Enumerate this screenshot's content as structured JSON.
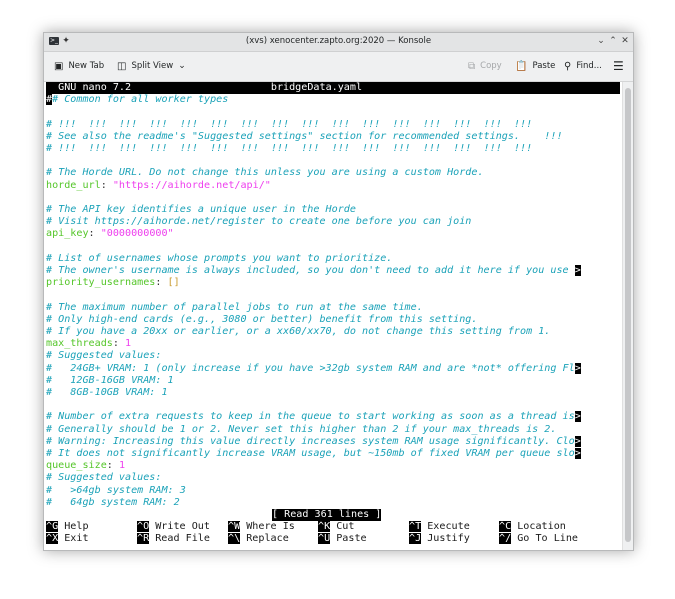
{
  "window": {
    "title": "(xvs) xenocenter.zapto.org:2020 — Konsole"
  },
  "toolbar": {
    "new_tab": "New Tab",
    "split_view": "Split View",
    "copy": "Copy",
    "paste": "Paste",
    "find": "Find..."
  },
  "nano": {
    "version": "GNU nano 7.2",
    "filename": "bridgeData.yaml",
    "status": "[ Read 361 lines ]"
  },
  "lines": {
    "l0": "# Common for all worker types",
    "l2": "# !!!  !!!  !!!  !!!  !!!  !!!  !!!  !!!  !!!  !!!  !!!  !!!  !!!  !!!  !!!  !!!",
    "l3": "# See also the readme's \"Suggested settings\" section for recommended settings.    !!!",
    "l4": "# !!!  !!!  !!!  !!!  !!!  !!!  !!!  !!!  !!!  !!!  !!!  !!!  !!!  !!!  !!!  !!!",
    "l6": "# The Horde URL. Do not change this unless you are using a custom Horde.",
    "l7k": "horde_url",
    "l7v": "\"https://aihorde.net/api/\"",
    "l9": "# The API key identifies a unique user in the Horde",
    "l10": "# Visit https://aihorde.net/register to create one before you can join",
    "l11k": "api_key",
    "l11v": "\"0000000000\"",
    "l13": "# List of usernames whose prompts you want to prioritize.",
    "l14": "# The owner's username is always included, so you don't need to add it here if you use ",
    "l15k": "priority_usernames",
    "l15v": "[]",
    "l17": "# The maximum number of parallel jobs to run at the same time.",
    "l18": "# Only high-end cards (e.g., 3080 or better) benefit from this setting.",
    "l19": "# If you have a 20xx or earlier, or a xx60/xx70, do not change this setting from 1.",
    "l20k": "max_threads",
    "l20v": "1",
    "l21": "# Suggested values:",
    "l22": "#   24GB+ VRAM: 1 (only increase if you have >32gb system RAM and are *not* offering Fl",
    "l23": "#   12GB-16GB VRAM: 1",
    "l24": "#   8GB-10GB VRAM: 1",
    "l26": "# Number of extra requests to keep in the queue to start working as soon as a thread is",
    "l27": "# Generally should be 1 or 2. Never set this higher than 2 if your max_threads is 2.",
    "l28": "# Warning: Increasing this value directly increases system RAM usage significantly. Clo",
    "l29": "# It does not significantly increase VRAM usage, but ~150mb of fixed VRAM per queue slo",
    "l30k": "queue_size",
    "l30v": "1",
    "l31": "# Suggested values:",
    "l32": "#   >64gb system RAM: 3",
    "l33": "#   64gb system RAM: 2",
    "more": ">"
  },
  "shortcuts": [
    {
      "key": "^G",
      "label": "Help"
    },
    {
      "key": "^O",
      "label": "Write Out"
    },
    {
      "key": "^W",
      "label": "Where Is"
    },
    {
      "key": "^K",
      "label": "Cut"
    },
    {
      "key": "^T",
      "label": "Execute"
    },
    {
      "key": "^C",
      "label": "Location"
    },
    {
      "key": "^X",
      "label": "Exit"
    },
    {
      "key": "^R",
      "label": "Read File"
    },
    {
      "key": "^\\",
      "label": "Replace"
    },
    {
      "key": "^U",
      "label": "Paste"
    },
    {
      "key": "^J",
      "label": "Justify"
    },
    {
      "key": "^/",
      "label": "Go To Line"
    }
  ]
}
